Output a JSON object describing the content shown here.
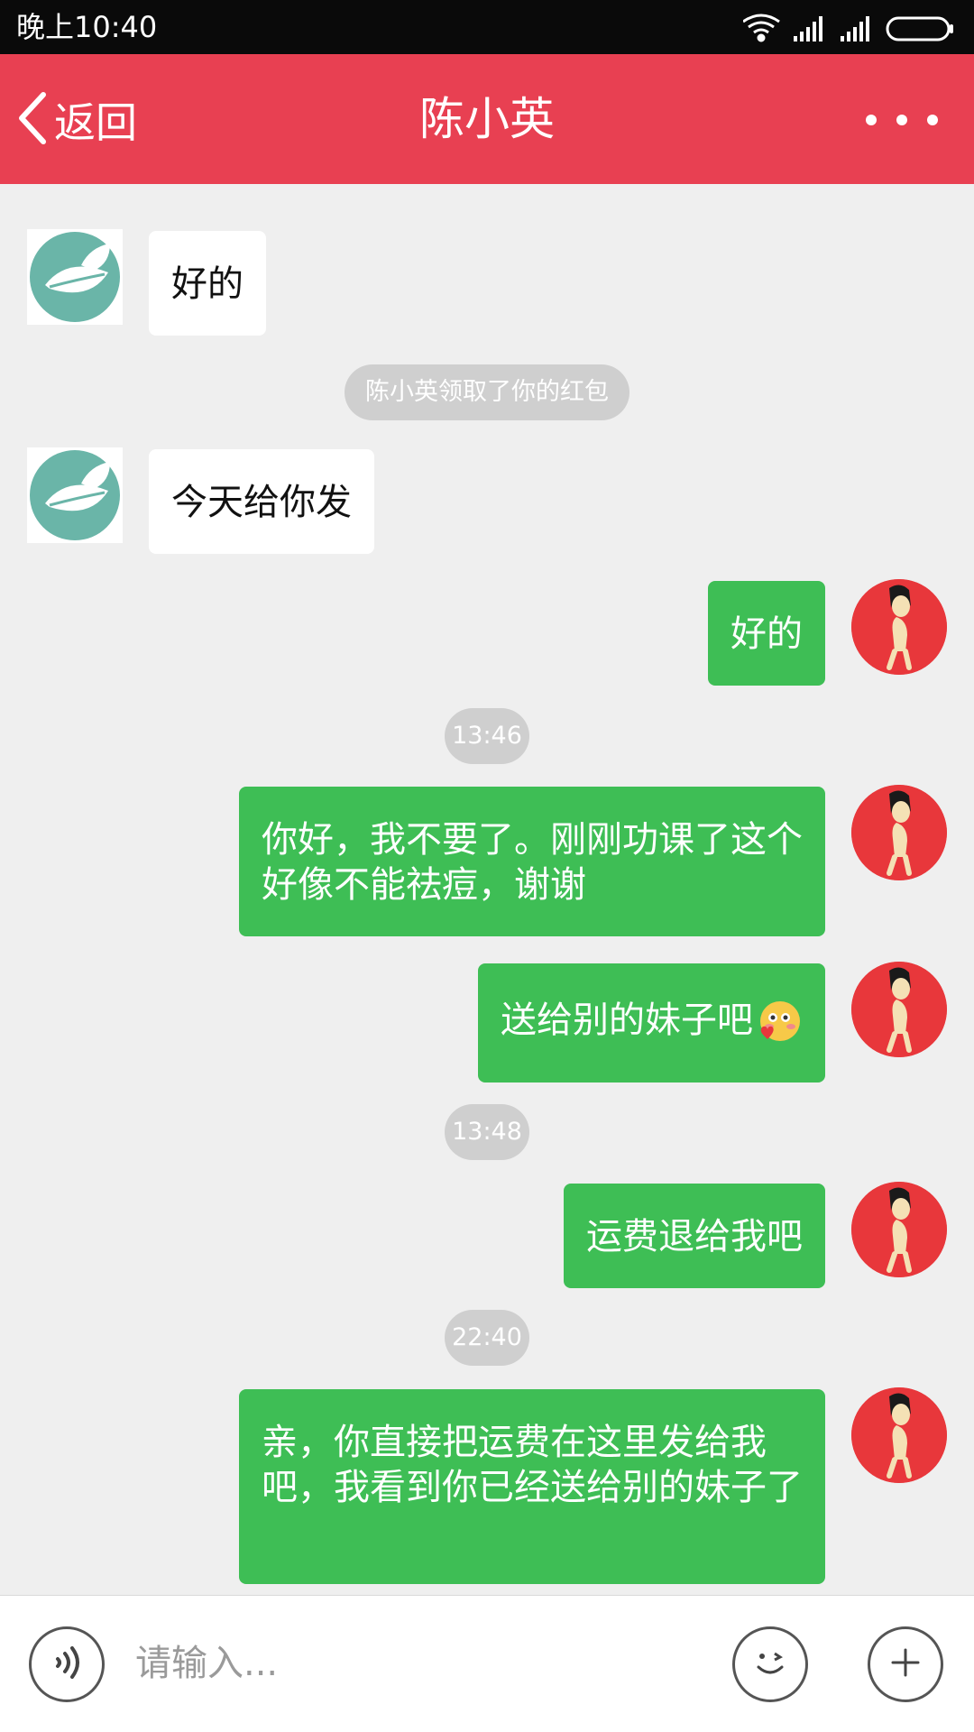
{
  "status_bar": {
    "time": "晚上10:40"
  },
  "header": {
    "back_label": "返回",
    "title": "陈小英"
  },
  "chat": {
    "system_notice": "陈小英领取了你的红包",
    "timestamps": [
      "13:46",
      "13:48",
      "22:40"
    ],
    "messages": [
      {
        "from": "contact",
        "text": "好的"
      },
      {
        "from": "contact",
        "text": "今天给你发"
      },
      {
        "from": "me",
        "text": "好的"
      },
      {
        "from": "me",
        "text": "你好，我不要了。刚刚功课了这个好像不能祛痘，谢谢"
      },
      {
        "from": "me",
        "text": "送给别的妹子吧"
      },
      {
        "from": "me",
        "text": "运费退给我吧"
      },
      {
        "from": "me",
        "text": "亲，你直接把运费在这里发给我吧，我看到你已经送给别的妹子了"
      }
    ]
  },
  "input_bar": {
    "placeholder": "请输入..."
  },
  "colors": {
    "header": "#e84052",
    "outgoing_bubble": "#3ebe55",
    "background": "#efefef"
  },
  "icons": [
    "back-chevron-icon",
    "more-dots-icon",
    "voice-icon",
    "emoji-icon",
    "plus-icon",
    "wifi-icon",
    "signal-icon",
    "battery-icon"
  ]
}
